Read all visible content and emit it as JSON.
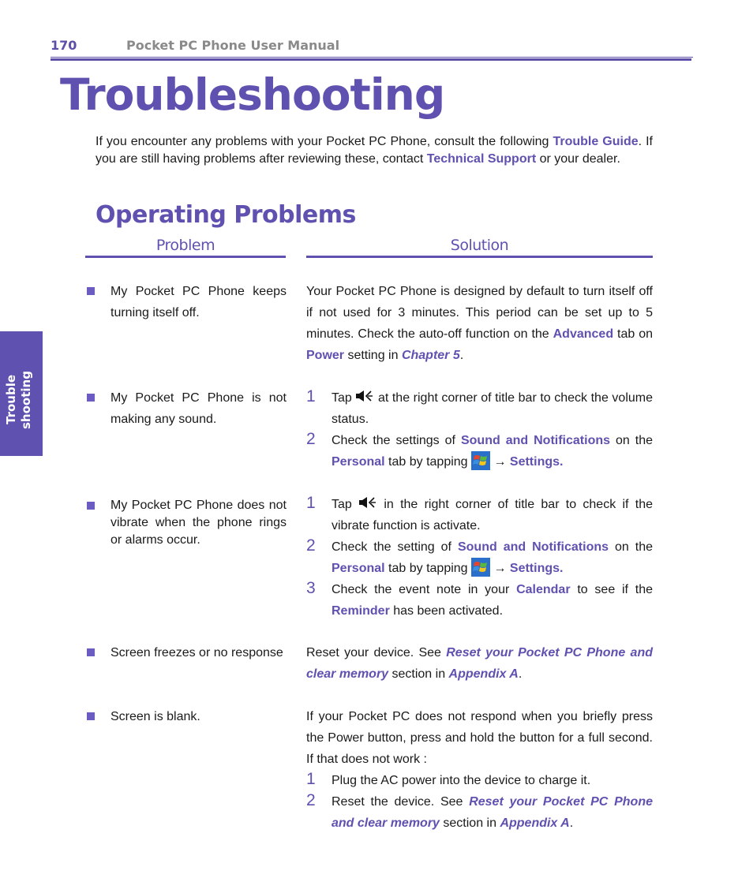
{
  "header": {
    "page_number": "170",
    "manual_title": "Pocket PC Phone User Manual"
  },
  "title": "Troubleshooting",
  "intro": {
    "t1": "If you encounter any problems with your Pocket PC Phone, consult the following ",
    "link1": "Trouble Guide",
    "t2": ". If you are still having problems after reviewing these, contact ",
    "link2": "Technical Support",
    "t3": " or your dealer."
  },
  "side_tab": {
    "line1": "Trouble",
    "line2": "shooting"
  },
  "section": {
    "title": "Operating Problems",
    "col_problem": "Problem",
    "col_solution": "Solution"
  },
  "icons": {
    "volume": "speaker-volume-icon",
    "start": "windows-start-icon"
  },
  "colors": {
    "accent": "#5f51b0",
    "header_gray": "#8a8a8a",
    "text": "#1a1a1a"
  },
  "rows": [
    {
      "problem": "My Pocket PC Phone keeps turning itself off.",
      "solution": {
        "t1": "Your Pocket PC Phone is designed by default to turn itself off if not used for 3 minutes.  This period can be set up to 5 minutes. Check the auto-off function on the ",
        "h1": "Advanced",
        "t2": " tab on ",
        "h2": "Power",
        "t3": " setting in ",
        "h3": "Chapter 5",
        "t4": "."
      }
    },
    {
      "problem": "My Pocket PC Phone is not making any sound.",
      "steps": [
        {
          "num": "1",
          "t1": "Tap ",
          "t2": " at the right corner of title bar to check the volume status."
        },
        {
          "num": "2",
          "t1": "Check the settings of ",
          "h1": "Sound and Notifications",
          "t2": " on the ",
          "h2": "Personal",
          "t3": " tab by tapping ",
          "arrow": " → ",
          "h3": "Settings."
        }
      ]
    },
    {
      "problem": "My Pocket PC Phone does not vibrate when the phone rings or alarms occur.",
      "steps": [
        {
          "num": "1",
          "t1": "Tap ",
          "t2": " in the right corner of title bar to check if the vibrate function is activate."
        },
        {
          "num": "2",
          "t1": "Check the setting of ",
          "h1": "Sound and Notifications",
          "t2": " on the  ",
          "h2": "Personal",
          "t3": " tab by tapping ",
          "arrow": " → ",
          "h3": "Settings."
        },
        {
          "num": "3",
          "t1": "Check the event note in  your ",
          "h1": "Calendar",
          "t2": " to see if the ",
          "h2": "Reminder",
          "t3": " has been activated."
        }
      ]
    },
    {
      "problem": "Screen freezes or no response",
      "solution": {
        "t1": "Reset your device.  See ",
        "h1": "Reset your Pocket PC Phone and clear memory",
        "t2": " section in ",
        "h2": "Appendix A",
        "t3": "."
      }
    },
    {
      "problem": "Screen is blank.",
      "solution": {
        "t1": "If your Pocket PC does not respond when you briefly press the Power button, press and hold the button for a full second.  If that does not work :"
      },
      "steps": [
        {
          "num": "1",
          "t1": "Plug the AC power into the device to charge it."
        },
        {
          "num": "2",
          "t1": "Reset the device. See ",
          "h1": "Reset your Pocket PC Phone and clear memory",
          "t2": " section in ",
          "h2": "Appendix A",
          "t3": "."
        }
      ]
    }
  ]
}
